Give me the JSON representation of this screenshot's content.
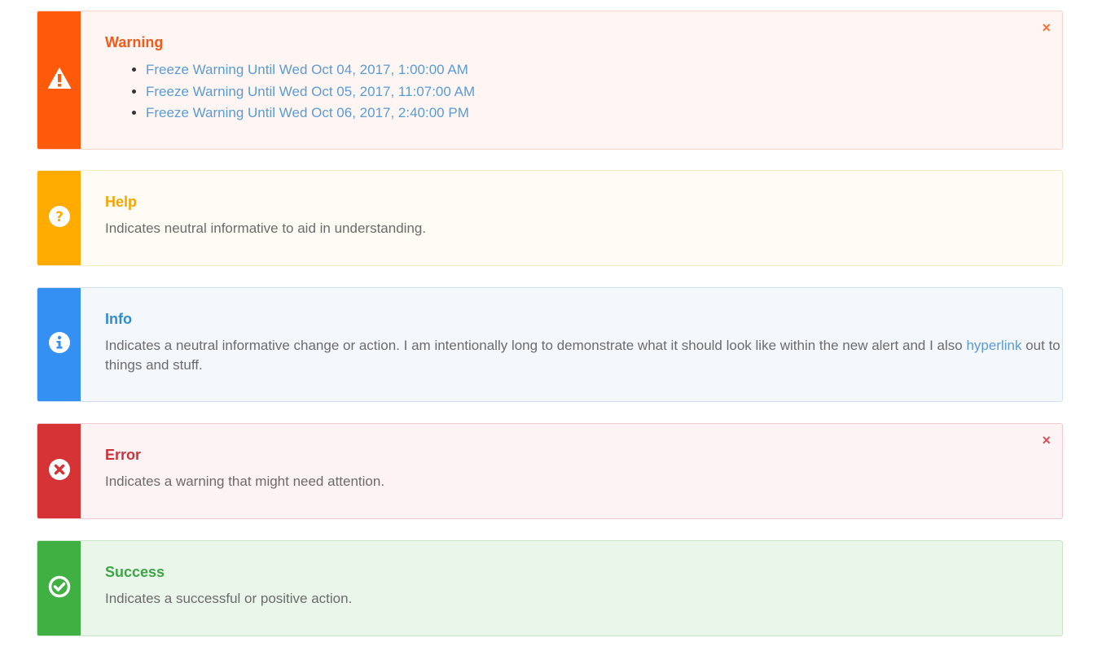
{
  "alerts": {
    "warning": {
      "title": "Warning",
      "icon": "warning-triangle-icon",
      "close_label": "×",
      "color": "#ff5a0a",
      "items": [
        "Freeze Warning Until Wed Oct 04, 2017, 1:00:00 AM",
        "Freeze Warning Until Wed Oct 05, 2017, 11:07:00 AM",
        "Freeze Warning Until Wed Oct 06, 2017, 2:40:00 PM"
      ]
    },
    "help": {
      "title": "Help",
      "icon": "question-circle-icon",
      "color": "#ffab00",
      "text": "Indicates neutral informative to aid in understanding."
    },
    "info": {
      "title": "Info",
      "icon": "info-circle-icon",
      "color": "#3490f3",
      "text_before": "Indicates a neutral informative change or action. I am intentionally long to demonstrate what it should look like within the new alert and I also ",
      "link_text": "hyperlink",
      "text_after": " out to things and stuff."
    },
    "error": {
      "title": "Error",
      "icon": "times-circle-icon",
      "close_label": "×",
      "color": "#d63336",
      "text": "Indicates a warning that might need attention."
    },
    "success": {
      "title": "Success",
      "icon": "check-circle-icon",
      "color": "#3fb041",
      "text": "Indicates a successful or positive action."
    }
  }
}
